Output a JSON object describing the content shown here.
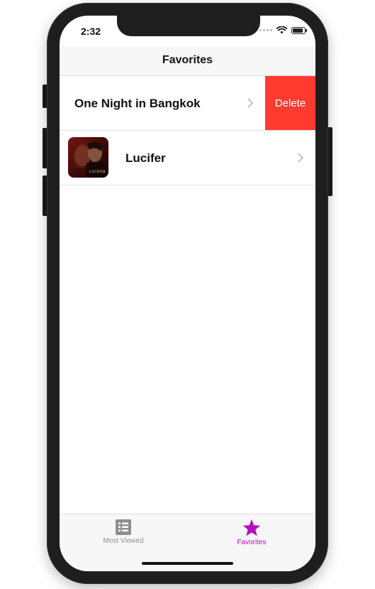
{
  "status_bar": {
    "time": "2:32"
  },
  "nav": {
    "title": "Favorites"
  },
  "favorites": [
    {
      "title": "One Night in Bangkok",
      "swipe_action": "Delete"
    },
    {
      "title": "Lucifer",
      "thumbnail": "lucifer-poster",
      "thumbnail_caption": "LUCIFER"
    }
  ],
  "tab_bar": {
    "tabs": [
      {
        "label": "Most Viewed",
        "icon": "list-icon",
        "selected": false
      },
      {
        "label": "Favorites",
        "icon": "star-icon",
        "selected": true
      }
    ]
  },
  "colors": {
    "delete": "#ff3b30",
    "tab_selected": "#b40fbf",
    "tab_unselected": "#8e8e93"
  }
}
